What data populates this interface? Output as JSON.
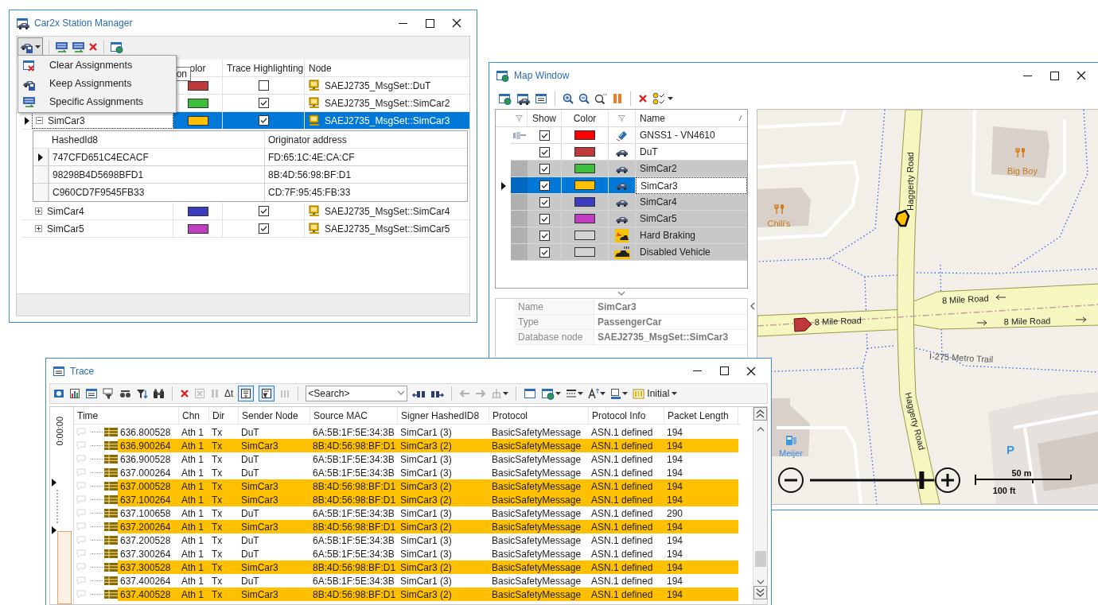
{
  "station_manager": {
    "title": "Car2x Station Manager",
    "menu": [
      {
        "label": "Clear Assignments"
      },
      {
        "label": "Keep Assignments"
      },
      {
        "label": "Specific Assignments"
      }
    ],
    "tooltip": "on",
    "columns": [
      "olor",
      "Trace Highlighting",
      "Node"
    ],
    "rows": [
      {
        "color": "#c0393b",
        "trace_highlighting": false,
        "node": "SAEJ2735_MsgSet::DuT",
        "selected": false
      },
      {
        "color": "#3cc03c",
        "trace_highlighting": true,
        "node": "SAEJ2735_MsgSet::SimCar2",
        "selected": false
      },
      {
        "name": "SimCar3",
        "expanded": true,
        "color": "#ffc000",
        "trace_highlighting": true,
        "node": "SAEJ2735_MsgSet::SimCar3",
        "selected": true,
        "details": {
          "columns": [
            "HashedId8",
            "Originator address"
          ],
          "rows": [
            {
              "cells": [
                "747CFD651C4ECACF",
                "FD:65:1C:4E:CA:CF"
              ],
              "selected": true
            },
            {
              "cells": [
                "98298B4D5698BFD1",
                "8B:4D:56:98:BF:D1"
              ],
              "selected": false
            },
            {
              "cells": [
                "C960CD7F9545FB33",
                "CD:7F:95:45:FB:33"
              ],
              "selected": false
            }
          ]
        }
      },
      {
        "name": "SimCar4",
        "expanded": false,
        "color": "#3c3cc0",
        "trace_highlighting": true,
        "node": "SAEJ2735_MsgSet::SimCar4",
        "selected": false
      },
      {
        "name": "SimCar5",
        "expanded": false,
        "color": "#c03cc0",
        "trace_highlighting": true,
        "node": "SAEJ2735_MsgSet::SimCar5",
        "selected": false
      }
    ]
  },
  "map_window": {
    "title": "Map Window",
    "columns": [
      "Show",
      "Color",
      "Name"
    ],
    "rows": [
      {
        "kind": "gnss",
        "name": "GNSS1 - VN4610",
        "show": true,
        "color": "#ff0000",
        "shaded": false,
        "selected": false
      },
      {
        "kind": "car",
        "name": "DuT",
        "show": true,
        "color": "#c0393b",
        "shaded": false,
        "selected": false
      },
      {
        "kind": "car",
        "name": "SimCar2",
        "show": true,
        "color": "#3cc03c",
        "shaded": true,
        "selected": false
      },
      {
        "kind": "car",
        "name": "SimCar3",
        "show": true,
        "color": "#ffc000",
        "shaded": true,
        "selected": true
      },
      {
        "kind": "car",
        "name": "SimCar4",
        "show": true,
        "color": "#3c3cc0",
        "shaded": true,
        "selected": false
      },
      {
        "kind": "car",
        "name": "SimCar5",
        "show": true,
        "color": "#c03cc0",
        "shaded": true,
        "selected": false
      },
      {
        "kind": "hard_braking",
        "name": "Hard Braking",
        "show": true,
        "color": "#d4d4d4",
        "shaded": true,
        "selected": false
      },
      {
        "kind": "disabled_vehicle",
        "name": "Disabled Vehicle",
        "show": true,
        "color": "#d4d4d4",
        "shaded": true,
        "selected": false
      }
    ],
    "properties": [
      {
        "label": "Name",
        "value": "SimCar3"
      },
      {
        "label": "Type",
        "value": "PassengerCar"
      },
      {
        "label": "Database node",
        "value": "SAEJ2735_MsgSet::SimCar3"
      }
    ],
    "map": {
      "places": [
        "Big Boy",
        "Chili's",
        "Meijer"
      ],
      "roads": [
        "Haggerty Road",
        "8 Mile Road",
        "8 Mile Road",
        "8 Mile Road",
        "I-275 Metro Trail",
        "Haggerty Road"
      ],
      "parking": "P",
      "scale": {
        "metric": "50 m",
        "imperial": "100 ft"
      },
      "zoom": {
        "level": 0.9
      }
    }
  },
  "trace": {
    "title": "Trace",
    "delta_label": "Δt",
    "toggles": [
      {
        "pressed": true
      },
      {
        "pressed": true
      }
    ],
    "search": {
      "placeholder": "<Search>"
    },
    "layout_button": "Initial",
    "ruler_time": "0:00:00",
    "columns": [
      "Time",
      "Chn",
      "Dir",
      "Sender Node",
      "Source MAC",
      "Signer HashedID8",
      "Protocol",
      "Protocol Info",
      "Packet Length"
    ],
    "rows": [
      {
        "cells": [
          "636.800528",
          "Ath 1",
          "Tx",
          "DuT",
          "6A:5B:1F:5E:34:3B",
          "SimCar1 (3)",
          "BasicSafetyMessage",
          "ASN.1 defined",
          "194"
        ],
        "highlighted": false
      },
      {
        "cells": [
          "636.900264",
          "Ath 1",
          "Tx",
          "SimCar3",
          "8B:4D:56:98:BF:D1",
          "SimCar3 (2)",
          "BasicSafetyMessage",
          "ASN.1 defined",
          "194"
        ],
        "highlighted": true
      },
      {
        "cells": [
          "636.900528",
          "Ath 1",
          "Tx",
          "DuT",
          "6A:5B:1F:5E:34:3B",
          "SimCar1 (3)",
          "BasicSafetyMessage",
          "ASN.1 defined",
          "194"
        ],
        "highlighted": false
      },
      {
        "cells": [
          "637.000264",
          "Ath 1",
          "Tx",
          "DuT",
          "6A:5B:1F:5E:34:3B",
          "SimCar1 (3)",
          "BasicSafetyMessage",
          "ASN.1 defined",
          "194"
        ],
        "highlighted": false
      },
      {
        "cells": [
          "637.000528",
          "Ath 1",
          "Tx",
          "SimCar3",
          "8B:4D:56:98:BF:D1",
          "SimCar3 (2)",
          "BasicSafetyMessage",
          "ASN.1 defined",
          "194"
        ],
        "highlighted": true
      },
      {
        "cells": [
          "637.100264",
          "Ath 1",
          "Tx",
          "SimCar3",
          "8B:4D:56:98:BF:D1",
          "SimCar3 (2)",
          "BasicSafetyMessage",
          "ASN.1 defined",
          "194"
        ],
        "highlighted": true
      },
      {
        "cells": [
          "637.100658",
          "Ath 1",
          "Tx",
          "DuT",
          "6A:5B:1F:5E:34:3B",
          "SimCar1 (3)",
          "BasicSafetyMessage",
          "ASN.1 defined",
          "290"
        ],
        "highlighted": false
      },
      {
        "cells": [
          "637.200264",
          "Ath 1",
          "Tx",
          "SimCar3",
          "8B:4D:56:98:BF:D1",
          "SimCar3 (2)",
          "BasicSafetyMessage",
          "ASN.1 defined",
          "194"
        ],
        "highlighted": true
      },
      {
        "cells": [
          "637.200528",
          "Ath 1",
          "Tx",
          "DuT",
          "6A:5B:1F:5E:34:3B",
          "SimCar1 (3)",
          "BasicSafetyMessage",
          "ASN.1 defined",
          "194"
        ],
        "highlighted": false
      },
      {
        "cells": [
          "637.300264",
          "Ath 1",
          "Tx",
          "DuT",
          "6A:5B:1F:5E:34:3B",
          "SimCar1 (3)",
          "BasicSafetyMessage",
          "ASN.1 defined",
          "194"
        ],
        "highlighted": false
      },
      {
        "cells": [
          "637.300528",
          "Ath 1",
          "Tx",
          "SimCar3",
          "8B:4D:56:98:BF:D1",
          "SimCar3 (2)",
          "BasicSafetyMessage",
          "ASN.1 defined",
          "194"
        ],
        "highlighted": true
      },
      {
        "cells": [
          "637.400264",
          "Ath 1",
          "Tx",
          "DuT",
          "6A:5B:1F:5E:34:3B",
          "SimCar1 (3)",
          "BasicSafetyMessage",
          "ASN.1 defined",
          "194"
        ],
        "highlighted": false
      },
      {
        "cells": [
          "637.400528",
          "Ath 1",
          "Tx",
          "SimCar3",
          "8B:4D:56:98:BF:D1",
          "SimCar3 (2)",
          "BasicSafetyMessage",
          "ASN.1 defined",
          "194"
        ],
        "highlighted": true
      }
    ]
  }
}
